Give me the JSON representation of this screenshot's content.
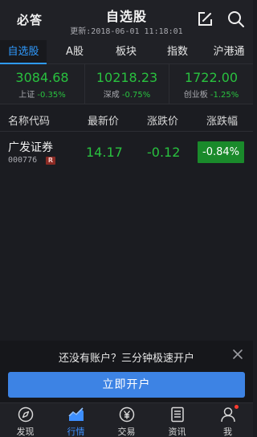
{
  "header": {
    "brand": "必答",
    "title": "自选股",
    "updated": "更新:2018-06-01 11:18:01",
    "edit_icon": "edit-icon",
    "search_icon": "search-icon"
  },
  "tabs": [
    {
      "label": "自选股",
      "active": true
    },
    {
      "label": "A股",
      "active": false
    },
    {
      "label": "板块",
      "active": false
    },
    {
      "label": "指数",
      "active": false
    },
    {
      "label": "沪港通",
      "active": false
    }
  ],
  "indices": [
    {
      "value": "3084.68",
      "name": "上证",
      "pct": "-0.35%"
    },
    {
      "value": "10218.23",
      "name": "深成",
      "pct": "-0.75%"
    },
    {
      "value": "1722.00",
      "name": "创业板",
      "pct": "-1.25%"
    }
  ],
  "columns": {
    "name_code": "名称代码",
    "latest_price": "最新价",
    "change": "涨跌价",
    "change_pct": "涨跌幅"
  },
  "stocks": [
    {
      "name": "广发证券",
      "code": "000776",
      "badge": "R",
      "price": "14.17",
      "change": "-0.12",
      "change_pct": "-0.84%"
    }
  ],
  "promo": {
    "text": "还没有账户？三分钟极速开户",
    "button": "立即开户"
  },
  "bottom_nav": [
    {
      "label": "发现",
      "icon": "compass-icon",
      "active": false
    },
    {
      "label": "行情",
      "icon": "chart-icon",
      "active": true
    },
    {
      "label": "交易",
      "icon": "yen-icon",
      "active": false
    },
    {
      "label": "资讯",
      "icon": "news-icon",
      "active": false
    },
    {
      "label": "我",
      "icon": "user-icon",
      "active": false,
      "notification": true
    }
  ],
  "colors": {
    "accent": "#2f9bff",
    "down_green": "#29c13f",
    "button_blue": "#3d83e4",
    "notification_red": "#ff3b30"
  }
}
